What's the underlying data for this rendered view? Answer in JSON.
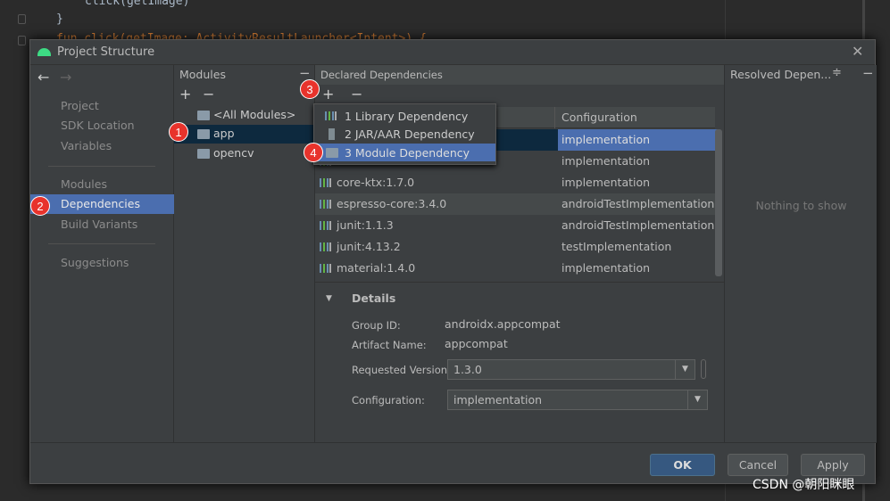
{
  "editor": {
    "lines": [
      "click(getImage)",
      "}",
      "fun click(getImage: ActivityResultLauncher<Intent>) {"
    ]
  },
  "dialog": {
    "title": "Project Structure",
    "nav": {
      "groups": [
        [
          "Project",
          "SDK Location",
          "Variables"
        ],
        [
          "Modules",
          "Dependencies",
          "Build Variants"
        ],
        [
          "Suggestions"
        ]
      ],
      "selected": "Dependencies"
    },
    "modules": {
      "header": "Modules",
      "items": [
        "<All Modules>",
        "app",
        "opencv"
      ],
      "selected": "app"
    },
    "declared": {
      "header": "Declared Dependencies",
      "columns": [
        "",
        "Configuration"
      ],
      "rows": [
        {
          "name": "",
          "config": "implementation",
          "selected": true
        },
        {
          "name": "",
          "config": "implementation"
        },
        {
          "name": "core-ktx:1.7.0",
          "config": "implementation"
        },
        {
          "name": "espresso-core:3.4.0",
          "config": "androidTestImplementation"
        },
        {
          "name": "junit:1.1.3",
          "config": "androidTestImplementation"
        },
        {
          "name": "junit:4.13.2",
          "config": "testImplementation"
        },
        {
          "name": "material:1.4.0",
          "config": "implementation"
        }
      ]
    },
    "add_menu": {
      "items": [
        "1  Library Dependency",
        "2  JAR/AAR Dependency",
        "3  Module Dependency"
      ],
      "highlighted": 2
    },
    "details": {
      "title": "Details",
      "group_label": "Group ID:",
      "group_value": "androidx.appcompat",
      "artifact_label": "Artifact Name:",
      "artifact_value": "appcompat",
      "version_label": "Requested Version:",
      "version_value": "1.3.0",
      "config_label": "Configuration:",
      "config_value": "implementation"
    },
    "resolved": {
      "header": "Resolved Depen...",
      "empty": "Nothing to show"
    },
    "buttons": {
      "ok": "OK",
      "cancel": "Cancel",
      "apply": "Apply"
    }
  },
  "badges": [
    "1",
    "2",
    "3",
    "4"
  ],
  "watermark": "CSDN @朝阳眯眼",
  "colors": {
    "selection": "#4b6eaf",
    "row_selected": "#0d293e",
    "badge": "#e8332c",
    "android": "#3ddc84"
  }
}
